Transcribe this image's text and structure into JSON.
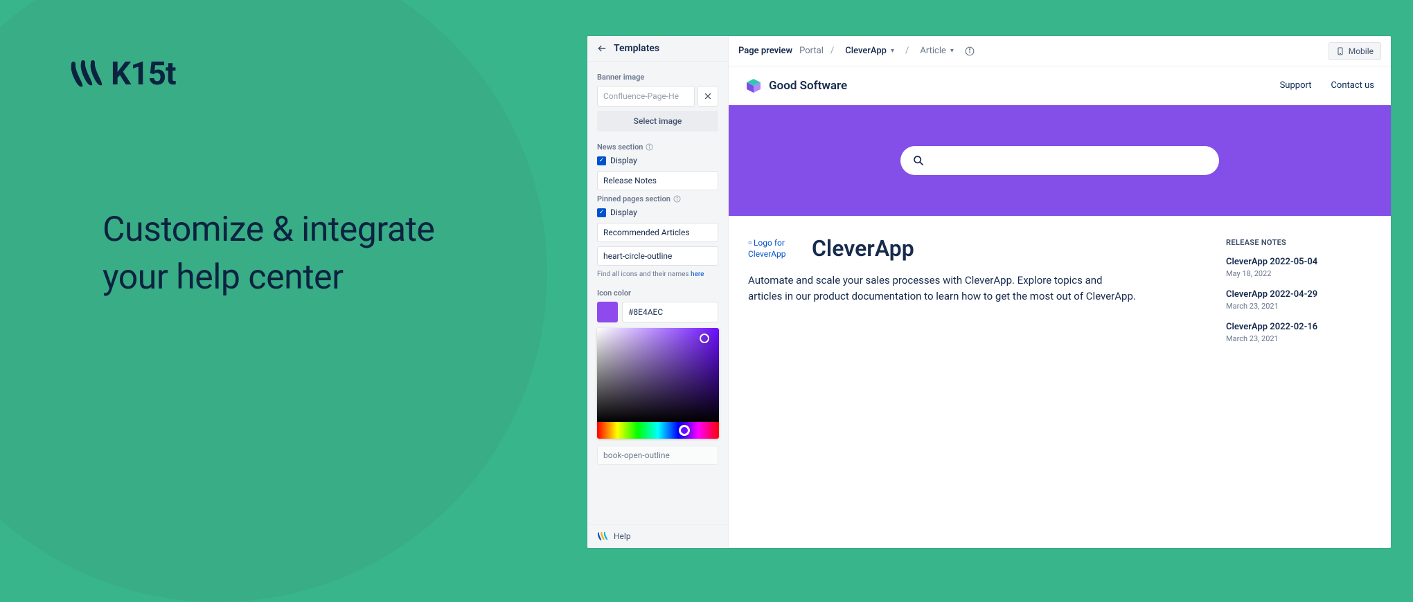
{
  "brand": {
    "name": "K15t"
  },
  "headline_line1": "Customize & integrate",
  "headline_line2": "your help center",
  "sidebar": {
    "back_icon": "arrow-left",
    "title": "Templates",
    "banner_label": "Banner image",
    "banner_value": "Confluence-Page-He",
    "select_image": "Select image",
    "news_label": "News section",
    "display_label": "Display",
    "release_notes_field": "Release Notes",
    "pinned_label": "Pinned pages section",
    "recommended_field": "Recommended Articles",
    "heart_field": "heart-circle-outline",
    "hint_prefix": "Find all icons and their names ",
    "hint_link": "here",
    "icon_color_label": "Icon color",
    "icon_color_value": "#8E4AEC",
    "hidden_field": "book-open-outline",
    "help": "Help"
  },
  "topbar": {
    "page_preview": "Page preview",
    "portal": "Portal",
    "app_dd": "CleverApp",
    "article_dd": "Article",
    "mobile": "Mobile"
  },
  "site": {
    "name": "Good Software",
    "link_support": "Support",
    "link_contact": "Contact us"
  },
  "page": {
    "logo_alt": "Logo for CleverApp",
    "title": "CleverApp",
    "description": "Automate and scale your sales processes with CleverApp. Explore topics and articles in our product documentation to learn how to get the most out of CleverApp."
  },
  "release_notes": {
    "heading": "RELEASE NOTES",
    "items": [
      {
        "title": "CleverApp 2022-05-04",
        "date": "May 18, 2022"
      },
      {
        "title": "CleverApp 2022-04-29",
        "date": "March 23, 2021"
      },
      {
        "title": "CleverApp 2022-02-16",
        "date": "March 23, 2021"
      }
    ]
  }
}
